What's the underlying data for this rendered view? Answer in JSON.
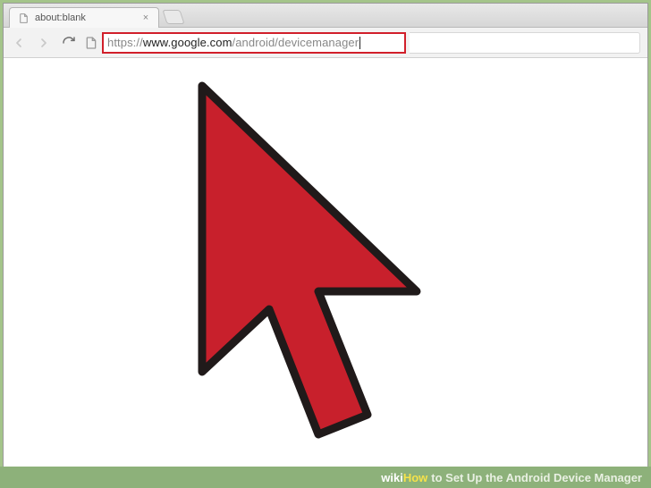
{
  "tab": {
    "title": "about:blank"
  },
  "address": {
    "protocol": "https://",
    "domain": "www.google.com",
    "path": "/android/devicemanager"
  },
  "footer": {
    "brand_wiki": "wiki",
    "brand_how": "How",
    "article_prefix": " to ",
    "article_title": "Set Up the Android Device Manager"
  }
}
